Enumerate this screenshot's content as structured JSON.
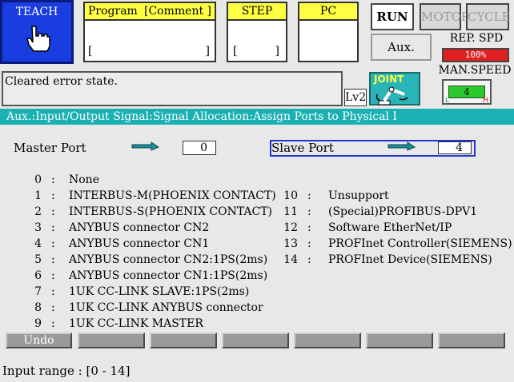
{
  "header": {
    "teach_label": "TEACH",
    "program_label": "Program",
    "comment_label": "[Comment ]",
    "program_bracket_open": "[",
    "program_bracket_close": "]",
    "step_label": "STEP",
    "step_bracket_open": "[",
    "step_bracket_close": "]",
    "pc_label": "PC",
    "run_label": "RUN",
    "motor_label": "MOTOR",
    "cycle_label": "CYCLE",
    "aux_label": "Aux.",
    "rep_spd_label": "REP. SPD",
    "rep_spd_value": "100%",
    "man_speed_label": "MAN.SPEED",
    "man_speed_value": "4",
    "man_speed_low": "L",
    "man_speed_high": "H",
    "message": "Cleared error state.",
    "level": "Lv2",
    "mode_label": "JOINT"
  },
  "path_title": "Aux.:Input/Output Signal:Signal Allocation:Assign Ports to Physical I",
  "ports": {
    "master_label": "Master Port",
    "master_value": "0",
    "slave_label": "Slave Port",
    "slave_value": "4"
  },
  "options_left": [
    {
      "num": "0",
      "sep": ":",
      "text": "None"
    },
    {
      "num": "1",
      "sep": ":",
      "text": "INTERBUS-M(PHOENIX CONTACT)"
    },
    {
      "num": "2",
      "sep": ":",
      "text": "INTERBUS-S(PHOENIX CONTACT)"
    },
    {
      "num": "3",
      "sep": ":",
      "text": "ANYBUS connector CN2"
    },
    {
      "num": "4",
      "sep": ":",
      "text": "ANYBUS connector CN1"
    },
    {
      "num": "5",
      "sep": ":",
      "text": "ANYBUS connector CN2:1PS(2ms)"
    },
    {
      "num": "6",
      "sep": ":",
      "text": "ANYBUS connector CN1:1PS(2ms)"
    },
    {
      "num": "7",
      "sep": ":",
      "text": "1UK CC-LINK SLAVE:1PS(2ms)"
    },
    {
      "num": "8",
      "sep": ":",
      "text": "1UK CC-LINK ANYBUS connector"
    },
    {
      "num": "9",
      "sep": ":",
      "text": "1UK CC-LINK MASTER"
    }
  ],
  "options_right": [
    {
      "num": "10",
      "sep": ":",
      "text": "Unsupport"
    },
    {
      "num": "11",
      "sep": ":",
      "text": "(Special)PROFIBUS-DPV1"
    },
    {
      "num": "12",
      "sep": ":",
      "text": "Software EtherNet/IP"
    },
    {
      "num": "13",
      "sep": ":",
      "text": "PROFInet Controller(SIEMENS)"
    },
    {
      "num": "14",
      "sep": ":",
      "text": "PROFInet Device(SIEMENS)"
    }
  ],
  "function_keys": [
    "Undo",
    "",
    "",
    "",
    "",
    "",
    ""
  ],
  "input_range": "Input range : [0  - 14]",
  "colors": {
    "teach_bg": "#1a3de0",
    "title_bar": "#1ab0b4",
    "yellow_header": "#ffff44",
    "rep_spd_bg": "#e02020",
    "man_speed_bar": "#2dc82d",
    "slave_focus_border": "#2233cc"
  },
  "icons": {
    "teach": "hand-pointer-icon",
    "mode": "robot-arm-icon",
    "port_arrow": "arrow-right-icon"
  }
}
